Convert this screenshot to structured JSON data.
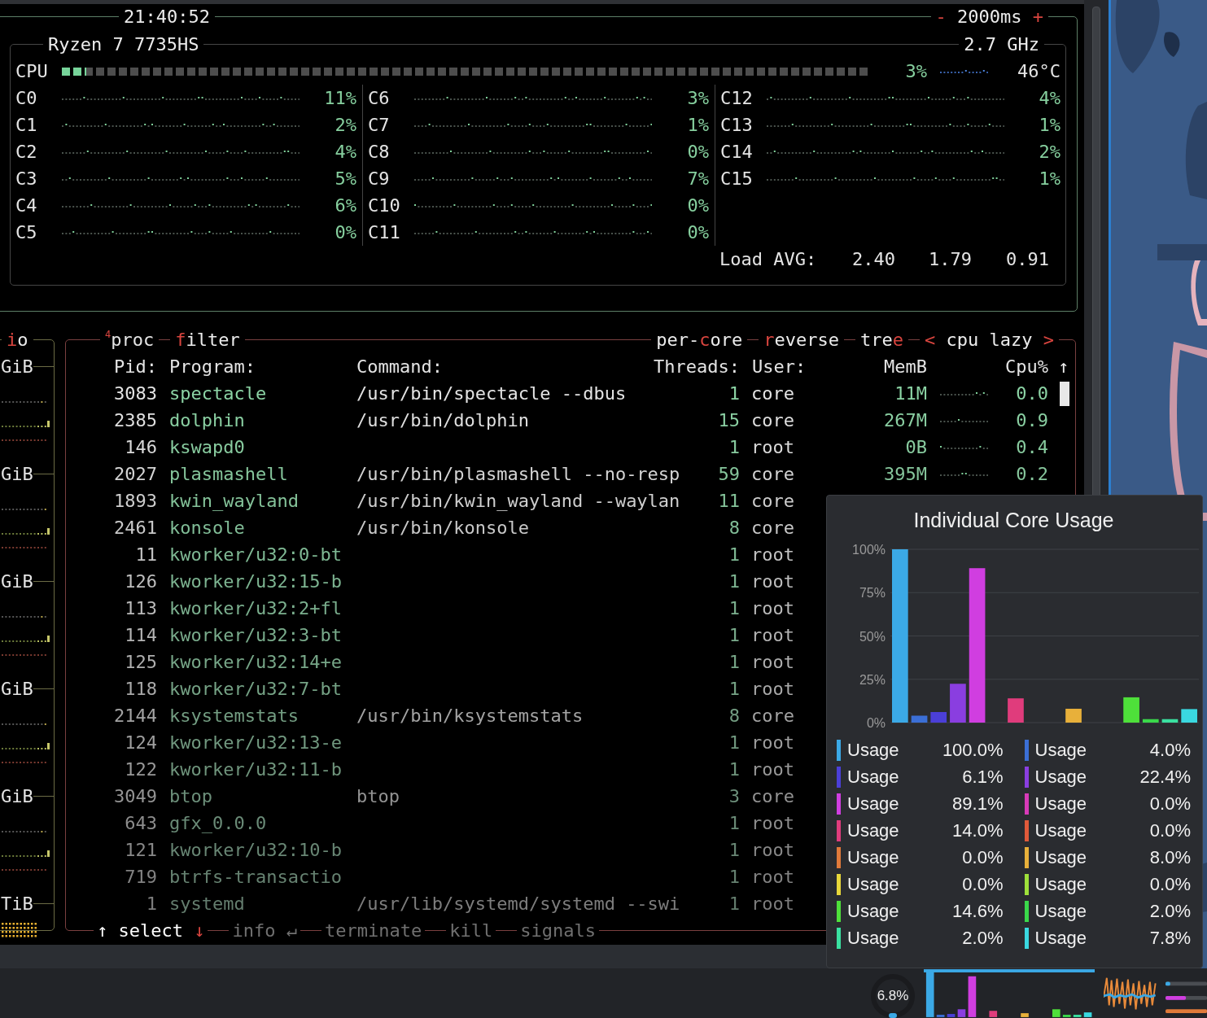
{
  "cpu_box": {
    "clock": "21:40:52",
    "interval": [
      {
        "text": "-",
        "hotkey": true
      },
      {
        "text": " 2000ms ",
        "hotkey": false
      },
      {
        "text": "+",
        "hotkey": true
      }
    ],
    "cpu_name": "Ryzen 7 7735HS",
    "frequency": "2.7 GHz",
    "total": {
      "label": "CPU",
      "level": 0.03,
      "reading": "3%",
      "temperature": "46°C"
    },
    "cores": [
      {
        "name": "C0",
        "reading": "11%"
      },
      {
        "name": "C1",
        "reading": "2%"
      },
      {
        "name": "C2",
        "reading": "4%"
      },
      {
        "name": "C3",
        "reading": "5%"
      },
      {
        "name": "C4",
        "reading": "6%"
      },
      {
        "name": "C5",
        "reading": "0%"
      },
      {
        "name": "C6",
        "reading": "3%"
      },
      {
        "name": "C7",
        "reading": "1%"
      },
      {
        "name": "C8",
        "reading": "0%"
      },
      {
        "name": "C9",
        "reading": "7%"
      },
      {
        "name": "C10",
        "reading": "0%"
      },
      {
        "name": "C11",
        "reading": "0%"
      },
      {
        "name": "C12",
        "reading": "4%"
      },
      {
        "name": "C13",
        "reading": "1%"
      },
      {
        "name": "C14",
        "reading": "2%"
      },
      {
        "name": "C15",
        "reading": "1%"
      }
    ],
    "load_avg": {
      "label": "Load AVG:",
      "values": [
        "2.40",
        "1.79",
        "0.91"
      ]
    }
  },
  "io_panel": {
    "title": [
      {
        "text": "i",
        "hotkey": true
      },
      {
        "text": "o",
        "hotkey": false
      }
    ],
    "labels": [
      "GiB",
      "GiB",
      "GiB",
      "GiB",
      "GiB",
      "TiB"
    ]
  },
  "proc_panel": {
    "title": "$^{4}$proc",
    "filter": [
      {
        "text": "f",
        "hotkey": true
      },
      {
        "text": "ilter",
        "hotkey": false
      }
    ],
    "options": [
      [
        {
          "text": "per-",
          "hotkey": false
        },
        {
          "text": "c",
          "hotkey": true
        },
        {
          "text": "ore",
          "hotkey": false
        }
      ],
      [
        {
          "text": "r",
          "hotkey": true
        },
        {
          "text": "everse",
          "hotkey": false
        }
      ],
      [
        {
          "text": "tre",
          "hotkey": false
        },
        {
          "text": "e",
          "hotkey": true
        }
      ],
      [
        {
          "text": "<",
          "hotkey": true
        },
        {
          "text": " cpu lazy ",
          "hotkey": false
        },
        {
          "text": ">",
          "hotkey": true
        }
      ]
    ],
    "columns": [
      "Pid:",
      "Program:",
      "Command:",
      "Threads:",
      "User:",
      "MemB",
      "Cpu%"
    ],
    "sort_arrow": "↑",
    "rows": [
      {
        "pid": "3083",
        "program": "spectacle",
        "command": "/usr/bin/spectacle --dbus",
        "threads": "1",
        "user": "core",
        "mem": "11M",
        "cpu": "0.0"
      },
      {
        "pid": "2385",
        "program": "dolphin",
        "command": "/usr/bin/dolphin",
        "threads": "15",
        "user": "core",
        "mem": "267M",
        "cpu": "0.9"
      },
      {
        "pid": "146",
        "program": "kswapd0",
        "threads": "1",
        "user": "root",
        "mem": "0B",
        "cpu": "0.4"
      },
      {
        "pid": "2027",
        "program": "plasmashell",
        "command": "/usr/bin/plasmashell --no-resp",
        "threads": "59",
        "user": "core",
        "mem": "395M",
        "cpu": "0.2"
      },
      {
        "pid": "1893",
        "program": "kwin_wayland",
        "command": "/usr/bin/kwin_wayland --waylan",
        "threads": "11",
        "user": "core"
      },
      {
        "pid": "2461",
        "program": "konsole",
        "command": "/usr/bin/konsole",
        "threads": "8",
        "user": "core"
      },
      {
        "pid": "11",
        "program": "kworker/u32:0-bt",
        "threads": "1",
        "user": "root"
      },
      {
        "pid": "126",
        "program": "kworker/u32:15-b",
        "threads": "1",
        "user": "root"
      },
      {
        "pid": "113",
        "program": "kworker/u32:2+fl",
        "threads": "1",
        "user": "root"
      },
      {
        "pid": "114",
        "program": "kworker/u32:3-bt",
        "threads": "1",
        "user": "root"
      },
      {
        "pid": "125",
        "program": "kworker/u32:14+e",
        "threads": "1",
        "user": "root"
      },
      {
        "pid": "118",
        "program": "kworker/u32:7-bt",
        "threads": "1",
        "user": "root"
      },
      {
        "pid": "2144",
        "program": "ksystemstats",
        "command": "/usr/bin/ksystemstats",
        "threads": "8",
        "user": "core"
      },
      {
        "pid": "124",
        "program": "kworker/u32:13-e",
        "threads": "1",
        "user": "root"
      },
      {
        "pid": "122",
        "program": "kworker/u32:11-b",
        "threads": "1",
        "user": "root"
      },
      {
        "pid": "3049",
        "program": "btop",
        "command": "btop",
        "threads": "3",
        "user": "core"
      },
      {
        "pid": "643",
        "program": "gfx_0.0.0",
        "threads": "1",
        "user": "root"
      },
      {
        "pid": "121",
        "program": "kworker/u32:10-b",
        "threads": "1",
        "user": "root"
      },
      {
        "pid": "719",
        "program": "btrfs-transactio",
        "threads": "1",
        "user": "root"
      },
      {
        "pid": "1",
        "program": "systemd",
        "command": "/usr/lib/systemd/systemd --swi",
        "threads": "1",
        "user": "root"
      }
    ],
    "footer": [
      {
        "disabled": false,
        "parts": [
          {
            "text": "↑",
            "hotkey": false
          },
          {
            "text": " select ",
            "hotkey": false
          },
          {
            "text": "↓",
            "hotkey": true
          }
        ]
      },
      {
        "disabled": true,
        "parts": [
          {
            "text": "info ↵",
            "hotkey": false
          }
        ]
      },
      {
        "disabled": true,
        "parts": [
          {
            "text": "terminate",
            "hotkey": false
          }
        ]
      },
      {
        "disabled": true,
        "parts": [
          {
            "text": "kill",
            "hotkey": false
          }
        ]
      },
      {
        "disabled": true,
        "parts": [
          {
            "text": "signals",
            "hotkey": false
          }
        ]
      }
    ]
  },
  "popup": {
    "title": "Individual Core Usage",
    "chart_data": {
      "type": "bar",
      "grid": true,
      "ylim": [
        0,
        100
      ],
      "yticks": [
        {
          "value": 0,
          "label": "0%"
        },
        {
          "value": 25,
          "label": "25%"
        },
        {
          "value": 50,
          "label": "50%"
        },
        {
          "value": 75,
          "label": "75%"
        },
        {
          "value": 100,
          "label": "100%"
        }
      ],
      "series": [
        {
          "name": "Usage",
          "color": "#3ba9e6",
          "values": [
            100.0
          ]
        },
        {
          "name": "Usage",
          "color": "#3b6fd6",
          "values": [
            4.0
          ]
        },
        {
          "name": "Usage",
          "color": "#4b3fd8",
          "values": [
            6.1
          ]
        },
        {
          "name": "Usage",
          "color": "#8a3ee0",
          "values": [
            22.4
          ]
        },
        {
          "name": "Usage",
          "color": "#d03ee0",
          "values": [
            89.1
          ]
        },
        {
          "name": "Usage",
          "color": "#d83ab8",
          "values": [
            0.0
          ]
        },
        {
          "name": "Usage",
          "color": "#e03c7c",
          "values": [
            14.0
          ]
        },
        {
          "name": "Usage",
          "color": "#e05a3a",
          "values": [
            0.0
          ]
        },
        {
          "name": "Usage",
          "color": "#e07a3a",
          "values": [
            0.0
          ]
        },
        {
          "name": "Usage",
          "color": "#e8b03a",
          "values": [
            8.0
          ]
        },
        {
          "name": "Usage",
          "color": "#e8d83a",
          "values": [
            0.0
          ]
        },
        {
          "name": "Usage",
          "color": "#9ee03a",
          "values": [
            0.0
          ]
        },
        {
          "name": "Usage",
          "color": "#4ee03a",
          "values": [
            14.6
          ]
        },
        {
          "name": "Usage",
          "color": "#3ad84a",
          "values": [
            2.0
          ]
        },
        {
          "name": "Usage",
          "color": "#3ae0a0",
          "values": [
            2.0
          ]
        },
        {
          "name": "Usage",
          "color": "#3ad8e0",
          "values": [
            7.8
          ]
        }
      ]
    },
    "legend": [
      "100.0%",
      "4.0%",
      "6.1%",
      "22.4%",
      "89.1%",
      "0.0%",
      "14.0%",
      "0.0%",
      "0.0%",
      "8.0%",
      "0.0%",
      "0.0%",
      "14.6%",
      "2.0%",
      "2.0%",
      "7.8%"
    ]
  },
  "taskbar": {
    "cpu_gauge": "6.8%"
  }
}
